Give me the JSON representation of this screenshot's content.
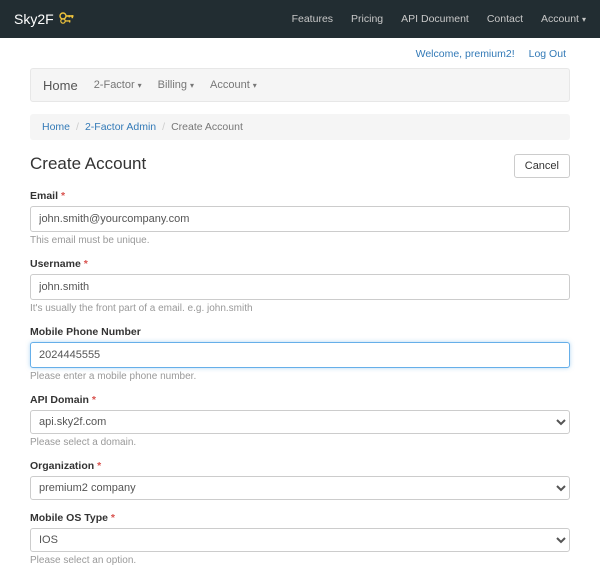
{
  "brand": "Sky2F",
  "nav": {
    "features": "Features",
    "pricing": "Pricing",
    "api_doc": "API Document",
    "contact": "Contact",
    "account": "Account"
  },
  "welcome": {
    "text": "Welcome, premium2!",
    "logout": "Log Out"
  },
  "subnav": {
    "home": "Home",
    "two_factor": "2-Factor",
    "billing": "Billing",
    "account": "Account"
  },
  "breadcrumb": {
    "home": "Home",
    "admin": "2-Factor Admin",
    "current": "Create Account"
  },
  "page": {
    "title": "Create Account",
    "cancel": "Cancel"
  },
  "form": {
    "email": {
      "label": "Email",
      "value": "john.smith@yourcompany.com",
      "help": "This email must be unique."
    },
    "username": {
      "label": "Username",
      "value": "john.smith",
      "help": "It's usually the front part of a email. e.g. john.smith"
    },
    "mobile": {
      "label": "Mobile Phone Number",
      "value": "2024445555",
      "help": "Please enter a mobile phone number."
    },
    "api_domain": {
      "label": "API Domain",
      "value": "api.sky2f.com",
      "help": "Please select a domain."
    },
    "organization": {
      "label": "Organization",
      "value": "premium2 company"
    },
    "os_type": {
      "label": "Mobile OS Type",
      "value": "IOS",
      "help": "Please select an option."
    }
  }
}
